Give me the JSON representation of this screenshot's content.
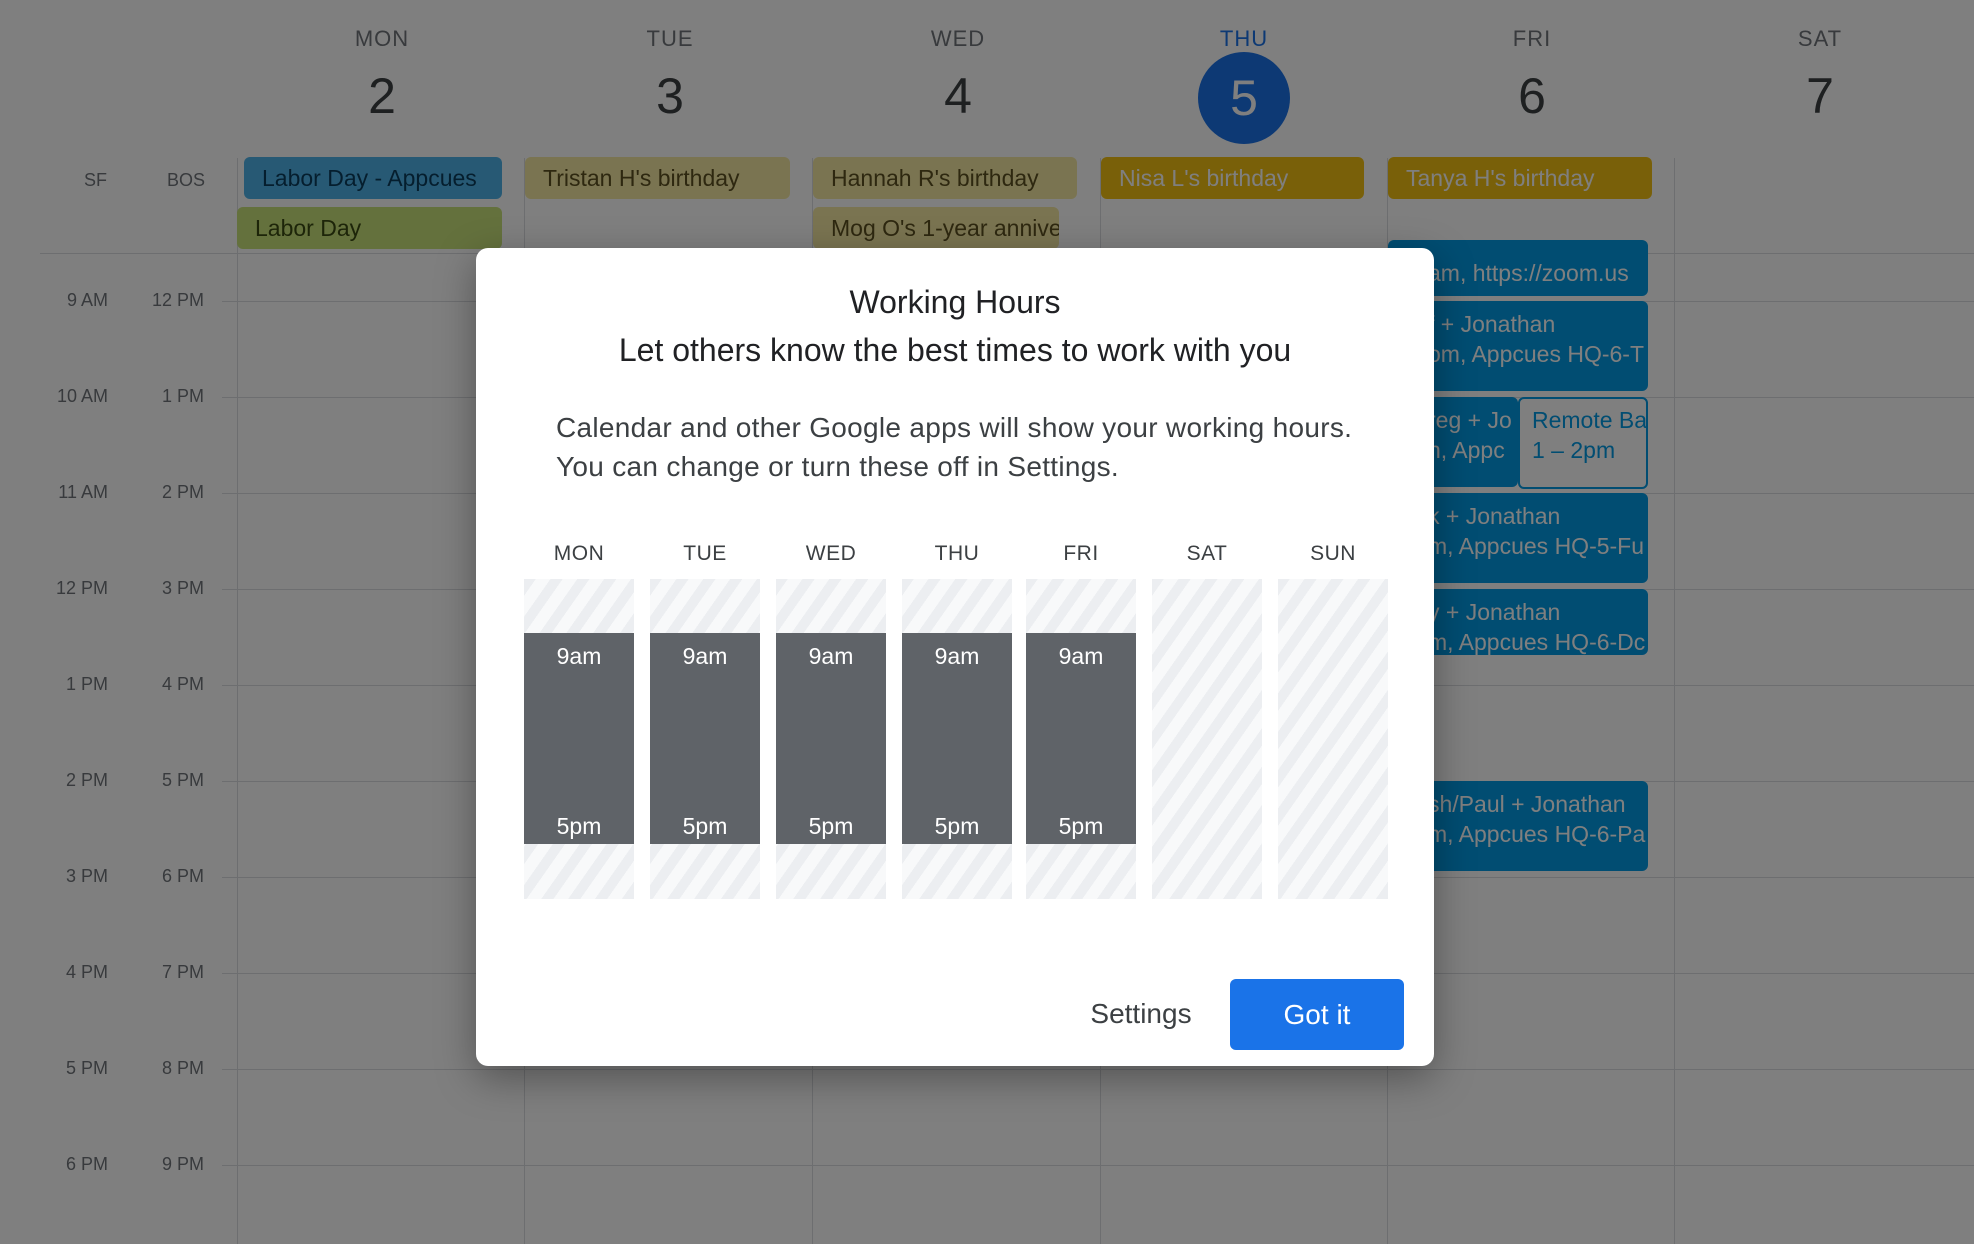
{
  "calendar": {
    "days": [
      {
        "name": "MON",
        "num": "2"
      },
      {
        "name": "TUE",
        "num": "3"
      },
      {
        "name": "WED",
        "num": "4"
      },
      {
        "name": "THU",
        "num": "5"
      },
      {
        "name": "FRI",
        "num": "6"
      },
      {
        "name": "SAT",
        "num": "7"
      }
    ],
    "tz_labels": [
      "SF",
      "BOS"
    ],
    "times_primary": [
      "9 AM",
      "10 AM",
      "11 AM",
      "12 PM",
      "1 PM",
      "2 PM",
      "3 PM",
      "4 PM",
      "5 PM",
      "6 PM"
    ],
    "times_secondary": [
      "12 PM",
      "1 PM",
      "2 PM",
      "3 PM",
      "4 PM",
      "5 PM",
      "6 PM",
      "7 PM",
      "8 PM",
      "9 PM"
    ],
    "allday": [
      {
        "text": "Labor Day - Appcues",
        "color": "#4fb3e8"
      },
      {
        "text": "Labor Day",
        "color": "#c9e27a"
      },
      {
        "text": "Tristan H's birthday",
        "color": "#f5e8a3"
      },
      {
        "text": "Hannah R's birthday",
        "color": "#f5e8a3"
      },
      {
        "text": "Mog O's 1-year annive",
        "color": "#f5e8a3"
      },
      {
        "text": "Nisa L's birthday",
        "color": "#f3c113"
      },
      {
        "text": "Tanya H's birthday",
        "color": "#f3c113"
      }
    ],
    "events": [
      {
        "line1": "am, https://zoom.us"
      },
      {
        "line1": "f + Jonathan",
        "line2": "om, Appcues HQ-6-T"
      },
      {
        "line1": "reg + Jo",
        "line2": "n, Appc"
      },
      {
        "line1": "k + Jonathan",
        "line2": "m, Appcues HQ-5-Fu"
      },
      {
        "line1": "y + Jonathan",
        "line2": "m, Appcues HQ-6-Dc"
      },
      {
        "line1": "sh/Paul + Jonathan",
        "line2": "m, Appcues HQ-6-Pa"
      }
    ],
    "outline_event": {
      "line1": "Remote Ba",
      "line2": "1 – 2pm"
    },
    "event_color": "#039be5"
  },
  "dialog": {
    "title": "Working Hours",
    "subtitle": "Let others know the best times to work with you",
    "body": "Calendar and other Google apps will show your working hours. You can change or turn these off in Settings.",
    "week": [
      {
        "day": "MON",
        "start": "9am",
        "end": "5pm"
      },
      {
        "day": "TUE",
        "start": "9am",
        "end": "5pm"
      },
      {
        "day": "WED",
        "start": "9am",
        "end": "5pm"
      },
      {
        "day": "THU",
        "start": "9am",
        "end": "5pm"
      },
      {
        "day": "FRI",
        "start": "9am",
        "end": "5pm"
      },
      {
        "day": "SAT"
      },
      {
        "day": "SUN"
      }
    ],
    "settings_label": "Settings",
    "gotit_label": "Got it",
    "accent_color": "#1a73e8"
  }
}
